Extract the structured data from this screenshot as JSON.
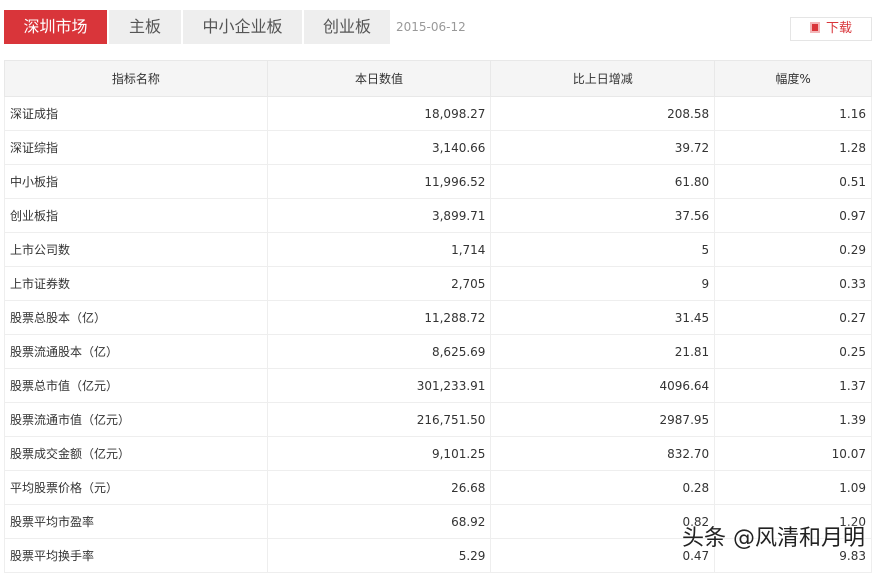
{
  "tabs": [
    "深圳市场",
    "主板",
    "中小企业板",
    "创业板"
  ],
  "date": "2015-06-12",
  "download_label": "下载",
  "columns": [
    "指标名称",
    "本日数值",
    "比上日增减",
    "幅度%"
  ],
  "rows": [
    [
      "深证成指",
      "18,098.27",
      "208.58",
      "1.16"
    ],
    [
      "深证综指",
      "3,140.66",
      "39.72",
      "1.28"
    ],
    [
      "中小板指",
      "11,996.52",
      "61.80",
      "0.51"
    ],
    [
      "创业板指",
      "3,899.71",
      "37.56",
      "0.97"
    ],
    [
      "上市公司数",
      "1,714",
      "5",
      "0.29"
    ],
    [
      "上市证券数",
      "2,705",
      "9",
      "0.33"
    ],
    [
      "股票总股本（亿）",
      "11,288.72",
      "31.45",
      "0.27"
    ],
    [
      "股票流通股本（亿）",
      "8,625.69",
      "21.81",
      "0.25"
    ],
    [
      "股票总市值（亿元）",
      "301,233.91",
      "4096.64",
      "1.37"
    ],
    [
      "股票流通市值（亿元）",
      "216,751.50",
      "2987.95",
      "1.39"
    ],
    [
      "股票成交金额（亿元）",
      "9,101.25",
      "832.70",
      "10.07"
    ],
    [
      "平均股票价格（元）",
      "26.68",
      "0.28",
      "1.09"
    ],
    [
      "股票平均市盈率",
      "68.92",
      "0.82",
      "1.20"
    ],
    [
      "股票平均换手率",
      "5.29",
      "0.47",
      "9.83"
    ]
  ],
  "watermark": "头条 @风清和月明"
}
